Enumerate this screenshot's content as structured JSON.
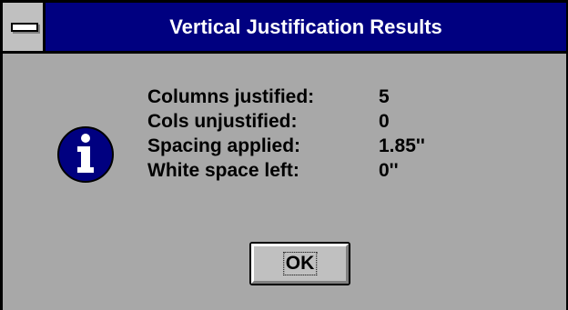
{
  "window": {
    "title": "Vertical Justification Results"
  },
  "icon": {
    "name": "info-icon",
    "glyph": "i",
    "color": "#000080"
  },
  "results": [
    {
      "label": "Columns justified:",
      "value": "5"
    },
    {
      "label": "Cols unjustified:",
      "value": "0"
    },
    {
      "label": "Spacing applied:",
      "value": "1.85''"
    },
    {
      "label": "White space left:",
      "value": "0''"
    }
  ],
  "buttons": {
    "ok_label": "OK"
  },
  "colors": {
    "titlebar": "#000080",
    "face": "#a8a8a8",
    "button_face": "#c0c0c0"
  }
}
